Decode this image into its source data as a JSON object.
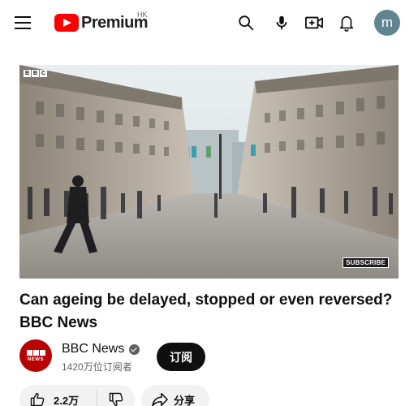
{
  "header": {
    "logo_text": "Premium",
    "region": "HK",
    "avatar_letter": "m",
    "avatar_color": "#5f8592",
    "icons": [
      "menu-icon",
      "search-icon",
      "microphone-icon",
      "create-video-icon",
      "notifications-bell-icon"
    ]
  },
  "video": {
    "watermark_letters": [
      "B",
      "B",
      "C"
    ],
    "subscribe_overlay": "SUBSCRIBE",
    "title": "Can ageing be delayed, stopped or even reversed? BBC News"
  },
  "channel": {
    "name": "BBC News",
    "subscribers": "1420万位订阅者",
    "avatar_letters": [
      "B",
      "B",
      "C"
    ],
    "avatar_caption": "NEWS",
    "avatar_color": "#b80000"
  },
  "actions": {
    "subscribe_label": "订阅",
    "like_count": "2.2万",
    "share_label": "分享"
  }
}
